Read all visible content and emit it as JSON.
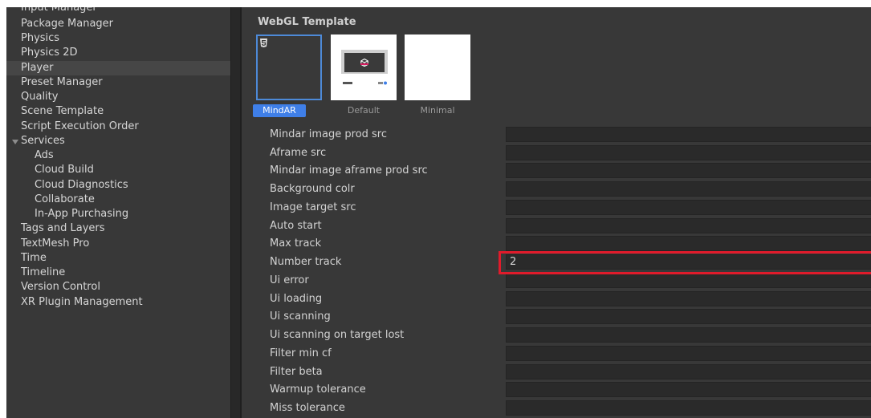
{
  "sidebar": {
    "items": [
      {
        "label": "Input Manager",
        "indent": 0
      },
      {
        "label": "Package Manager",
        "indent": 0
      },
      {
        "label": "Physics",
        "indent": 0
      },
      {
        "label": "Physics 2D",
        "indent": 0
      },
      {
        "label": "Player",
        "indent": 0,
        "selected": true
      },
      {
        "label": "Preset Manager",
        "indent": 0
      },
      {
        "label": "Quality",
        "indent": 0
      },
      {
        "label": "Scene Template",
        "indent": 0
      },
      {
        "label": "Script Execution Order",
        "indent": 0
      },
      {
        "label": "Services",
        "indent": 0,
        "expanded": true
      },
      {
        "label": "Ads",
        "indent": 1
      },
      {
        "label": "Cloud Build",
        "indent": 1
      },
      {
        "label": "Cloud Diagnostics",
        "indent": 1
      },
      {
        "label": "Collaborate",
        "indent": 1
      },
      {
        "label": "In-App Purchasing",
        "indent": 1
      },
      {
        "label": "Tags and Layers",
        "indent": 0
      },
      {
        "label": "TextMesh Pro",
        "indent": 0
      },
      {
        "label": "Time",
        "indent": 0
      },
      {
        "label": "Timeline",
        "indent": 0
      },
      {
        "label": "Version Control",
        "indent": 0
      },
      {
        "label": "XR Plugin Management",
        "indent": 0
      }
    ]
  },
  "webgl": {
    "section_title": "WebGL Template",
    "templates": [
      {
        "label": "MindAR",
        "selected": true
      },
      {
        "label": "Default"
      },
      {
        "label": "Minimal"
      }
    ],
    "properties": [
      {
        "label": "Mindar image prod src",
        "value": ""
      },
      {
        "label": "Aframe src",
        "value": ""
      },
      {
        "label": "Mindar image aframe prod src",
        "value": ""
      },
      {
        "label": "Background colr",
        "value": ""
      },
      {
        "label": "Image target src",
        "value": ""
      },
      {
        "label": "Auto start",
        "value": ""
      },
      {
        "label": "Max track",
        "value": ""
      },
      {
        "label": "Number track",
        "value": "2",
        "highlighted": true
      },
      {
        "label": "Ui error",
        "value": ""
      },
      {
        "label": "Ui loading",
        "value": ""
      },
      {
        "label": "Ui scanning",
        "value": ""
      },
      {
        "label": "Ui scanning on target lost",
        "value": ""
      },
      {
        "label": "Filter min cf",
        "value": ""
      },
      {
        "label": "Filter beta",
        "value": ""
      },
      {
        "label": "Warmup tolerance",
        "value": ""
      },
      {
        "label": "Miss tolerance",
        "value": ""
      }
    ]
  },
  "colors": {
    "background": "#383838",
    "selected_template": "#3f7fe8",
    "highlight_box": "#e01b2b"
  }
}
